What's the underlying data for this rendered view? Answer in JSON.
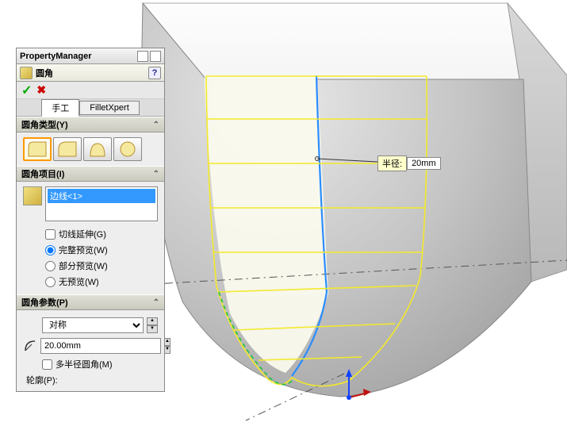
{
  "header": {
    "title": "PropertyManager"
  },
  "feature": {
    "title": "圆角",
    "help": "?"
  },
  "tabs": {
    "manual": "手工",
    "expert": "FilletXpert"
  },
  "sections": {
    "type": {
      "title": "圆角类型(Y)"
    },
    "items": {
      "title": "圆角项目(I)",
      "selected": "边线<1>",
      "tangent": "切线延伸(G)",
      "full_preview": "完整预览(W)",
      "partial_preview": "部分预览(W)",
      "no_preview": "无预览(W)"
    },
    "params": {
      "title": "圆角参数(P)",
      "symmetry": "对称",
      "radius": "20.00mm",
      "multi_radius": "多半径圆角(M)",
      "profile_label": "轮廓(P):"
    }
  },
  "callout": {
    "label": "半径:",
    "value": "20mm"
  }
}
